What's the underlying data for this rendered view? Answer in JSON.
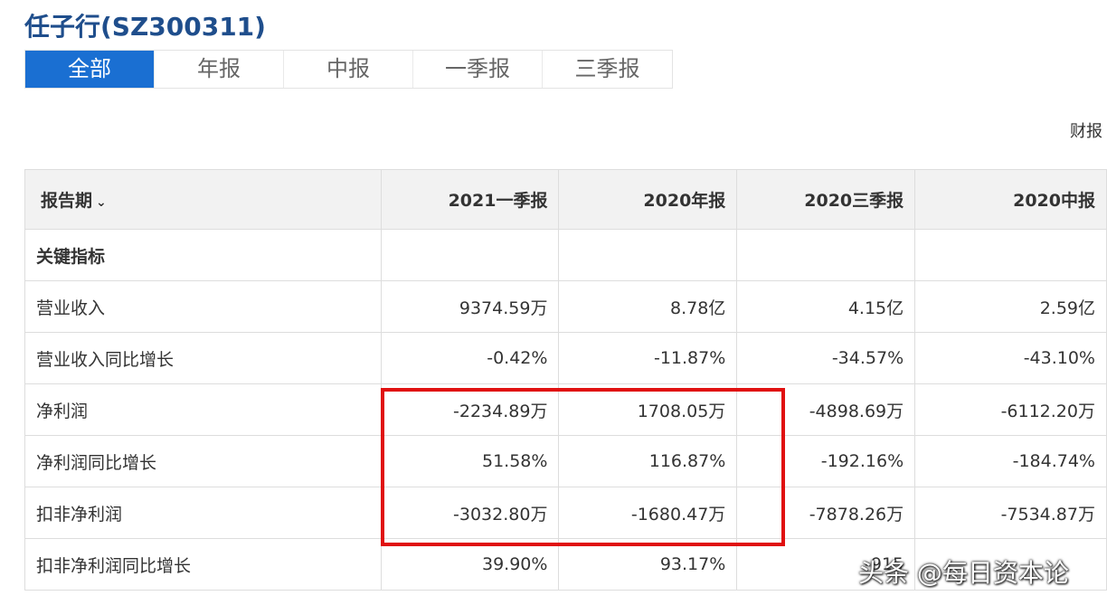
{
  "page_title": "任子行(SZ300311)",
  "tabs": [
    {
      "label": "全部",
      "active": true
    },
    {
      "label": "年报",
      "active": false
    },
    {
      "label": "中报",
      "active": false
    },
    {
      "label": "一季报",
      "active": false
    },
    {
      "label": "三季报",
      "active": false
    }
  ],
  "report_link": "财报",
  "table": {
    "header_label": "报告期",
    "chevron_icon": "chevron-down-icon",
    "columns": [
      "2021一季报",
      "2020年报",
      "2020三季报",
      "2020中报"
    ],
    "section_title": "关键指标",
    "rows": [
      {
        "label": "营业收入",
        "values": [
          "9374.59万",
          "8.78亿",
          "4.15亿",
          "2.59亿"
        ]
      },
      {
        "label": "营业收入同比增长",
        "values": [
          "-0.42%",
          "-11.87%",
          "-34.57%",
          "-43.10%"
        ]
      },
      {
        "label": "净利润",
        "values": [
          "-2234.89万",
          "1708.05万",
          "-4898.69万",
          "-6112.20万"
        ]
      },
      {
        "label": "净利润同比增长",
        "values": [
          "51.58%",
          "116.87%",
          "-192.16%",
          "-184.74%"
        ]
      },
      {
        "label": "扣非净利润",
        "values": [
          "-3032.80万",
          "-1680.47万",
          "-7878.26万",
          "-7534.87万"
        ]
      },
      {
        "label": "扣非净利润同比增长",
        "values": [
          "39.90%",
          "93.17%",
          "-915",
          ""
        ]
      }
    ]
  },
  "highlight_color": "#e01010",
  "accent_color": "#1a6fd2",
  "watermark": "头条 @每日资本论"
}
